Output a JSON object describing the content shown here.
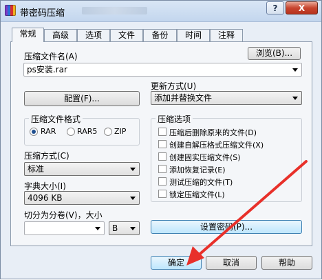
{
  "window": {
    "title": "带密码压缩",
    "help_glyph": "?",
    "close_glyph": "X",
    "accent_close": "#c8452f",
    "arrow_color": "#e8302a"
  },
  "tabs": [
    "常规",
    "高级",
    "选项",
    "文件",
    "备份",
    "时间",
    "注释"
  ],
  "archive": {
    "name_label": "压缩文件名(A)",
    "browse_label": "浏览(B)...",
    "name_value": "ps安装.rar"
  },
  "profiles_button": "配置(F)...",
  "update": {
    "label": "更新方式(U)",
    "value": "添加并替换文件"
  },
  "format": {
    "title": "压缩文件格式",
    "options": [
      "RAR",
      "RAR5",
      "ZIP"
    ],
    "selected": "RAR"
  },
  "compression": {
    "label": "压缩方式(C)",
    "value": "标准"
  },
  "dictionary": {
    "label": "字典大小(I)",
    "value": "4096 KB"
  },
  "split": {
    "label": "切分为分卷(V)，大小",
    "value": "",
    "unit": "B"
  },
  "options": {
    "title": "压缩选项",
    "items": [
      "压缩后删除原来的文件(D)",
      "创建自解压格式压缩文件(X)",
      "创建固实压缩文件(S)",
      "添加恢复记录(E)",
      "测试压缩的文件(T)",
      "锁定压缩文件(L)"
    ]
  },
  "set_password_button": "设置密码(P)...",
  "footer": {
    "ok": "确定",
    "cancel": "取消",
    "help": "帮助"
  }
}
